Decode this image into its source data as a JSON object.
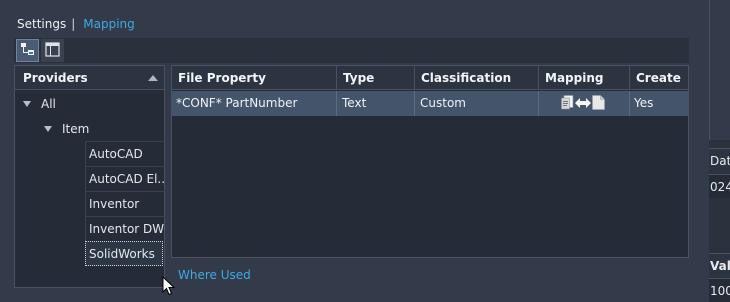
{
  "nav": {
    "settings": "Settings",
    "separator": "|",
    "mapping": "Mapping"
  },
  "toolbar": {
    "buttons": [
      {
        "icon": "tree-view-icon",
        "active": true
      },
      {
        "icon": "table-view-icon",
        "active": false
      }
    ]
  },
  "providers": {
    "header": "Providers",
    "tree": {
      "all": "All",
      "item": "Item",
      "leaves": [
        "AutoCAD",
        "AutoCAD El...",
        "Inventor",
        "Inventor DWG",
        "SolidWorks"
      ],
      "selected": "SolidWorks"
    }
  },
  "grid": {
    "columns": [
      "File Property",
      "Type",
      "Classification",
      "Mapping",
      "Create"
    ],
    "rows": [
      {
        "file_property": "*CONF* PartNumber",
        "type": "Text",
        "classification": "Custom",
        "mapping_icons": [
          "file-property-icon",
          "bidirectional-arrow-icon",
          "document-icon"
        ],
        "create": "Yes"
      }
    ]
  },
  "where_used": "Where Used",
  "right_panel": {
    "label_1": "Data",
    "label_2": "024",
    "label_3": "Val",
    "label_4": "100"
  },
  "colors": {
    "background": "#333b4a",
    "panel": "#262c37",
    "header": "#2d3441",
    "selected_row": "#44546a",
    "link": "#3fa9e0"
  }
}
